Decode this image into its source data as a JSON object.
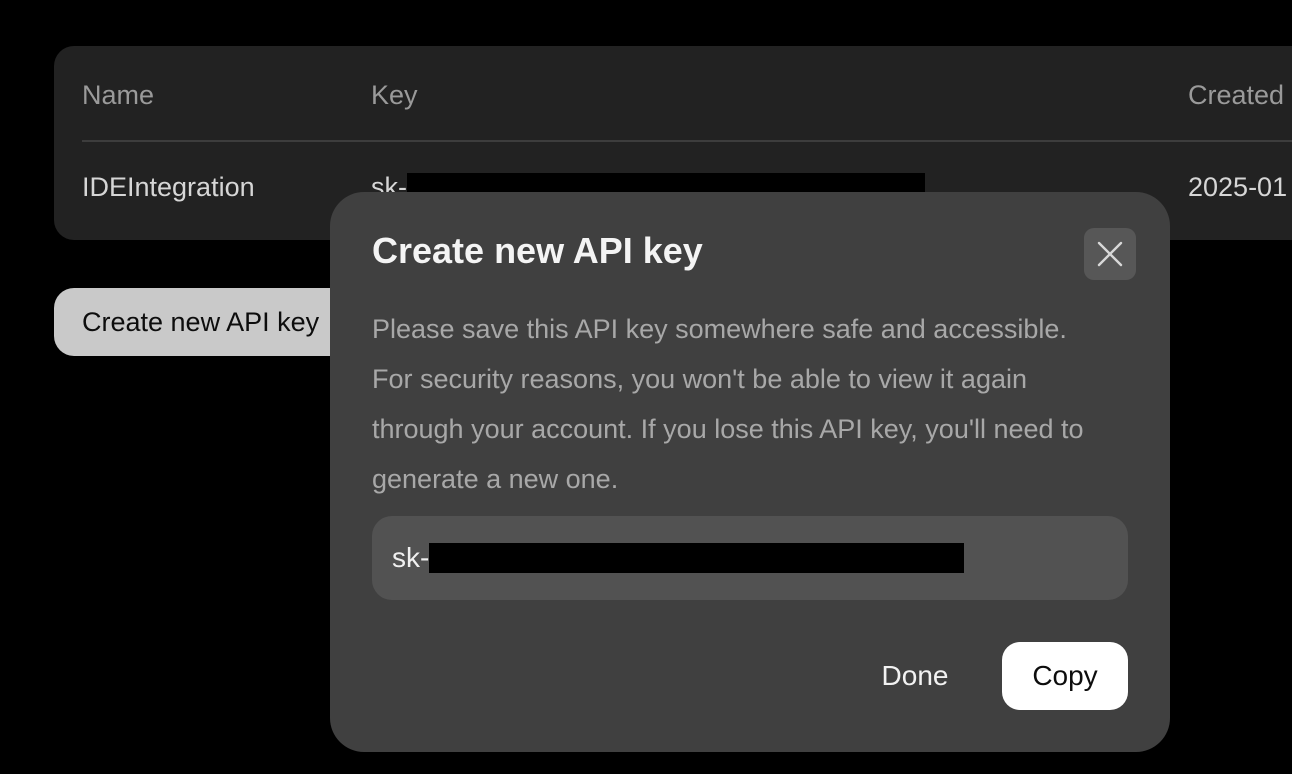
{
  "table": {
    "headers": {
      "name": "Name",
      "key": "Key",
      "created": "Created"
    },
    "rows": [
      {
        "name": "IDEIntegration",
        "key_prefix": "sk-",
        "created": "2025-01"
      }
    ]
  },
  "create_button": {
    "label": "Create new API key"
  },
  "modal": {
    "title": "Create new API key",
    "close_icon": "close-icon",
    "description": "Please save this API key somewhere safe and accessible. For security reasons, you won't be able to view it again through your account. If you lose this API key, you'll need to generate a new one.",
    "key_prefix": "sk-",
    "done_label": "Done",
    "copy_label": "Copy"
  },
  "colors": {
    "background": "#000000",
    "card": "#222222",
    "modal": "#404040",
    "field": "#525252",
    "primary_button": "#ffffff"
  }
}
